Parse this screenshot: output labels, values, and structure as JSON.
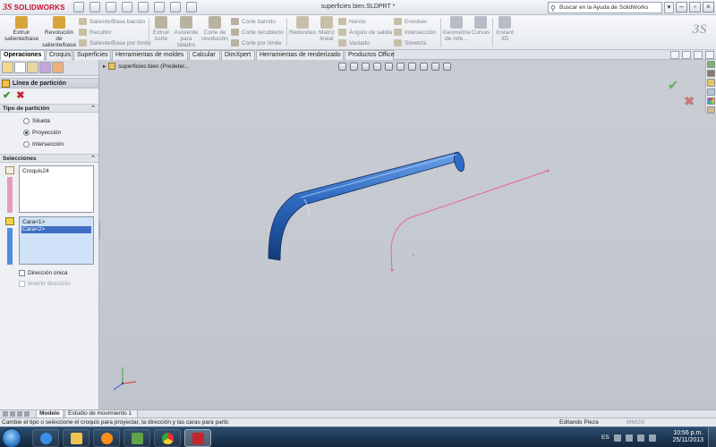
{
  "titlebar": {
    "brand_prefix": "3S",
    "brand_name": "SOLIDWORKS",
    "document_title": "superficies bien.SLDPRT *",
    "help_search_placeholder": "Buscar en la Ayuda de SolidWorks"
  },
  "commands": {
    "extrude_boss": "Extruir saliente/base",
    "revolve_boss": "Revolución de saliente/base",
    "swept_boss": "Saliente/Base barrido",
    "cover": "Recubrir",
    "boundary_boss": "Saliente/Base por límite",
    "extrude_cut": "Extruir corte",
    "hole_wizard": "Asistente para taladro",
    "revolve_cut": "Corte de revolución",
    "swept_cut": "Corte barrido",
    "lofted_cut": "Corte recubierto",
    "boundary_cut": "Corte por límite",
    "fillet": "Redondeo",
    "linear_pattern": "Matriz lineal",
    "rib": "Nervio",
    "draft": "Ángulo de salida",
    "shell": "Vaciado",
    "wrap": "Envolver",
    "intersect": "Intersección",
    "mirror": "Simetría",
    "ref_geometry": "Geometría de refe...",
    "curves": "Curvas",
    "instant3d": "Instant 3D"
  },
  "tabs": [
    "Operaciones",
    "Croquis",
    "Superficies",
    "Herramientas de moldes",
    "Calcular",
    "DimXpert",
    "Herramientas de renderizado",
    "Productos Office"
  ],
  "property_manager": {
    "title": "Línea de partición",
    "partition_type_title": "Tipo de partición",
    "options": [
      "Silueta",
      "Proyección",
      "Intersección"
    ],
    "selected_option": "Proyección",
    "selections_title": "Selecciones",
    "sketch_selection": "Croquis24",
    "faces": [
      "Cara<1>",
      "Cara<2>"
    ],
    "single_direction": "Dirección única",
    "reverse_direction": "Invertir dirección"
  },
  "graphics": {
    "tree_item": "superficies bien  (Predeter...",
    "tube_color": "#2a63b8",
    "sketch_color": "#e8679c"
  },
  "bottom_tabs": [
    "Modelo",
    "Estudio de movimiento 1"
  ],
  "status": {
    "message": "Cambie el tipo o seleccione el croquis para proyectar, la dirección y las caras para partir.",
    "mode": "Editando Pieza",
    "units": "MMGS"
  },
  "taskbar": {
    "language": "ES",
    "time": "10:56 p.m.",
    "date": "25/11/2013"
  }
}
